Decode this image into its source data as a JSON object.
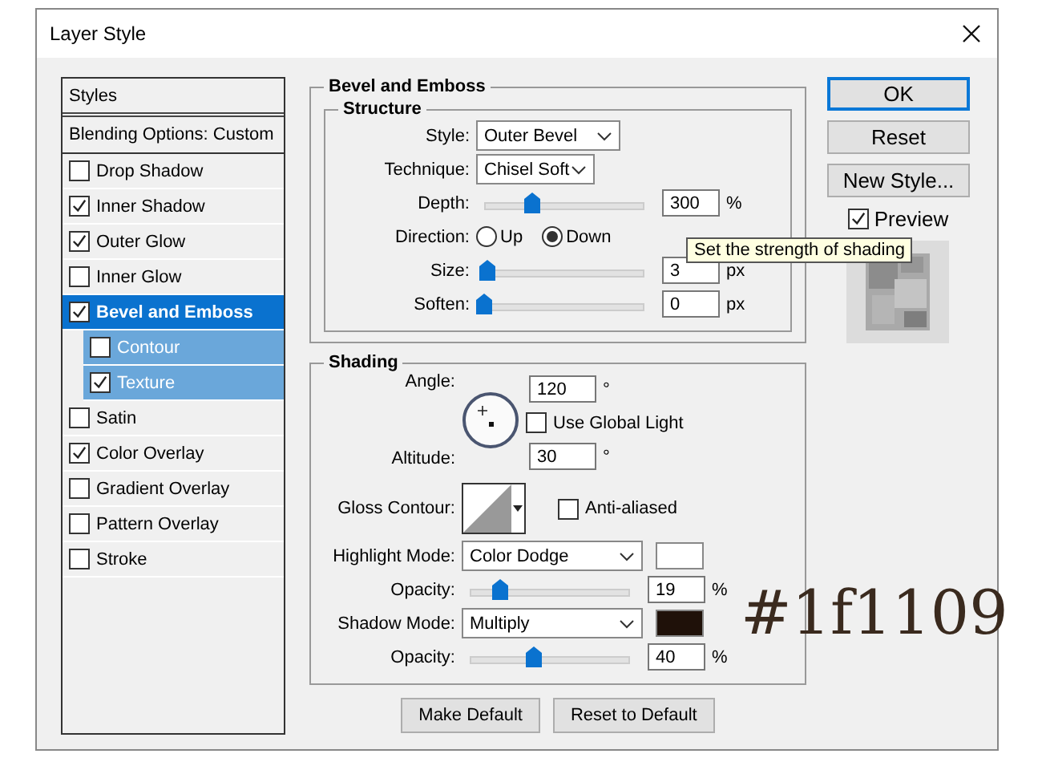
{
  "window": {
    "title": "Layer Style"
  },
  "styles_panel": {
    "header": "Styles",
    "blending": "Blending Options: Custom",
    "items": [
      {
        "label": "Drop Shadow",
        "checked": false,
        "selected": false
      },
      {
        "label": "Inner Shadow",
        "checked": true,
        "selected": false
      },
      {
        "label": "Outer Glow",
        "checked": true,
        "selected": false
      },
      {
        "label": "Inner Glow",
        "checked": false,
        "selected": false
      },
      {
        "label": "Bevel and Emboss",
        "checked": true,
        "selected": true,
        "children": [
          {
            "label": "Contour",
            "checked": false,
            "selected": false
          },
          {
            "label": "Texture",
            "checked": true,
            "selected": false
          }
        ]
      },
      {
        "label": "Satin",
        "checked": false,
        "selected": false
      },
      {
        "label": "Color Overlay",
        "checked": true,
        "selected": false
      },
      {
        "label": "Gradient Overlay",
        "checked": false,
        "selected": false
      },
      {
        "label": "Pattern Overlay",
        "checked": false,
        "selected": false
      },
      {
        "label": "Stroke",
        "checked": false,
        "selected": false
      }
    ]
  },
  "bevel_and_emboss": {
    "title": "Bevel and Emboss",
    "structure": {
      "title": "Structure",
      "style": {
        "label": "Style:",
        "value": "Outer Bevel"
      },
      "technique": {
        "label": "Technique:",
        "value": "Chisel Soft"
      },
      "depth": {
        "label": "Depth:",
        "level": 0.3,
        "value": "300",
        "unit": "%"
      },
      "direction": {
        "label": "Direction:",
        "options": [
          {
            "label": "Up",
            "selected": false
          },
          {
            "label": "Down",
            "selected": true
          }
        ]
      },
      "size": {
        "label": "Size:",
        "level": 0.02,
        "value": "3",
        "unit": "px"
      },
      "soften": {
        "label": "Soften:",
        "level": 0.0,
        "value": "0",
        "unit": "px"
      }
    }
  },
  "shading": {
    "title": "Shading",
    "angle": {
      "label": "Angle:",
      "value": "120",
      "unit": "°"
    },
    "use_global_light": {
      "label": "Use Global Light",
      "checked": false
    },
    "altitude": {
      "label": "Altitude:",
      "value": "30",
      "unit": "°"
    },
    "gloss_contour": {
      "label": "Gloss Contour:"
    },
    "anti_aliased": {
      "label": "Anti-aliased",
      "checked": false
    },
    "highlight_mode": {
      "label": "Highlight Mode:",
      "value": "Color Dodge",
      "color": "#ffffff"
    },
    "highlight_opacity": {
      "label": "Opacity:",
      "level": 0.19,
      "value": "19",
      "unit": "%"
    },
    "shadow_mode": {
      "label": "Shadow Mode:",
      "value": "Multiply",
      "color": "#1f1109"
    },
    "shadow_opacity": {
      "label": "Opacity:",
      "level": 0.4,
      "value": "40",
      "unit": "%"
    }
  },
  "footer_buttons": [
    "Make Default",
    "Reset to Default"
  ],
  "actions": [
    {
      "label": "OK",
      "default": true
    },
    {
      "label": "Reset",
      "default": false
    },
    {
      "label": "New Style...",
      "default": false
    }
  ],
  "preview": {
    "label": "Preview",
    "checked": true
  },
  "tooltip": "Set the strength of shading",
  "annotation": "#1f1109"
}
